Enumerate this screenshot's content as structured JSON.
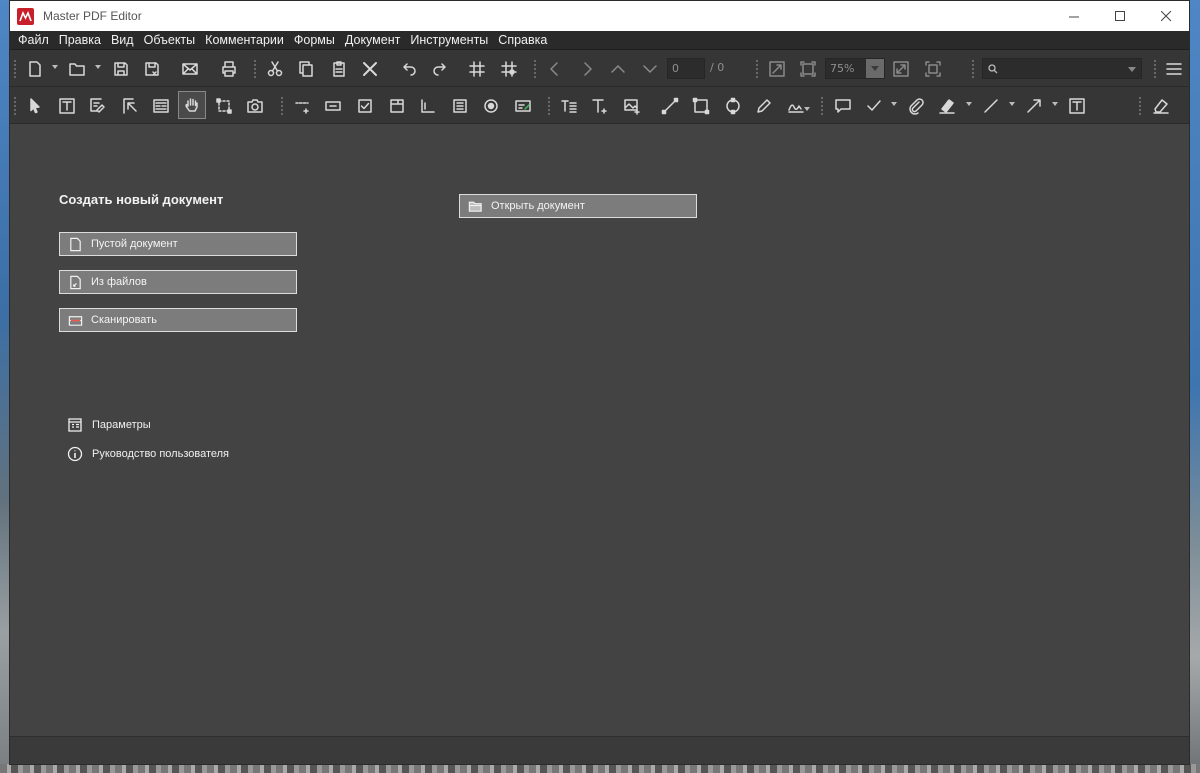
{
  "window": {
    "title": "Master PDF Editor"
  },
  "menu": [
    "Файл",
    "Правка",
    "Вид",
    "Объекты",
    "Комментарии",
    "Формы",
    "Документ",
    "Инструменты",
    "Справка"
  ],
  "toolbar": {
    "page_value": "0",
    "page_total": "/ 0",
    "zoom_value": "75%",
    "search_value": ""
  },
  "start": {
    "heading": "Создать новый документ",
    "blank_label": "Пустой документ",
    "from_files_label": "Из файлов",
    "scan_label": "Сканировать",
    "open_label": "Открыть документ",
    "settings_label": "Параметры",
    "guide_label": "Руководство пользователя"
  },
  "colors": {
    "accent": "#c8202b",
    "workspace": "#434343",
    "menubar": "#2a2a2a",
    "toolbar": "#363636"
  }
}
